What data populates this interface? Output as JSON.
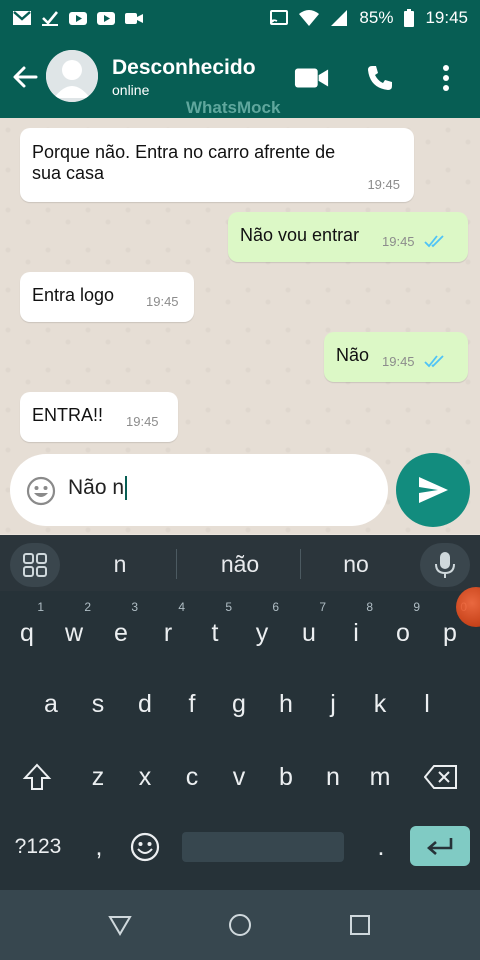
{
  "status_bar": {
    "battery": "85%",
    "time": "19:45",
    "icons": [
      "gmail-icon",
      "check-icon",
      "youtube-icon",
      "youtube-icon",
      "video-icon",
      "cast-icon",
      "wifi-icon",
      "signal-icon",
      "battery-icon"
    ]
  },
  "header": {
    "contact_name": "Desconhecido",
    "contact_status": "online",
    "watermark": "WhatsMock",
    "icons": [
      "back-arrow-icon",
      "avatar-icon",
      "video-call-icon",
      "phone-icon",
      "more-icon"
    ]
  },
  "messages": [
    {
      "direction": "in",
      "text_line1": "Porque não. Entra no carro afrente de",
      "text_line2": "sua casa",
      "time": "19:45"
    },
    {
      "direction": "out",
      "text": "Não vou entrar",
      "time": "19:45",
      "status": "read"
    },
    {
      "direction": "in",
      "text": "Entra logo",
      "time": "19:45"
    },
    {
      "direction": "out",
      "text": "Não",
      "time": "19:45",
      "status": "read"
    },
    {
      "direction": "in",
      "text": "ENTRA!!",
      "time": "19:45"
    }
  ],
  "composer": {
    "value": "Não n",
    "icons": [
      "emoji-icon",
      "send-icon"
    ]
  },
  "keyboard": {
    "suggestions": [
      "n",
      "não",
      "no"
    ],
    "row1": [
      {
        "key": "q",
        "hint": "1"
      },
      {
        "key": "w",
        "hint": "2"
      },
      {
        "key": "e",
        "hint": "3"
      },
      {
        "key": "r",
        "hint": "4"
      },
      {
        "key": "t",
        "hint": "5"
      },
      {
        "key": "y",
        "hint": "6"
      },
      {
        "key": "u",
        "hint": "7"
      },
      {
        "key": "i",
        "hint": "8"
      },
      {
        "key": "o",
        "hint": "9"
      },
      {
        "key": "p",
        "hint": "0"
      }
    ],
    "row2": [
      "a",
      "s",
      "d",
      "f",
      "g",
      "h",
      "j",
      "k",
      "l"
    ],
    "row3": [
      "z",
      "x",
      "c",
      "v",
      "b",
      "n",
      "m"
    ],
    "symbols_key": "?123",
    "comma_key": ",",
    "period_key": ".",
    "icons": [
      "grid-icon",
      "mic-icon",
      "shift-icon",
      "backspace-icon",
      "emoji-key-icon",
      "enter-icon"
    ]
  },
  "nav_bar": {
    "icons": [
      "back-triangle-icon",
      "home-circle-icon",
      "recents-square-icon"
    ]
  },
  "colors": {
    "primary": "#075e54",
    "accent": "#128c7e",
    "outgoing_bubble": "#dcf8c6",
    "incoming_bubble": "#ffffff",
    "read_ticks": "#4fc3f7",
    "keyboard_bg": "#263238"
  }
}
